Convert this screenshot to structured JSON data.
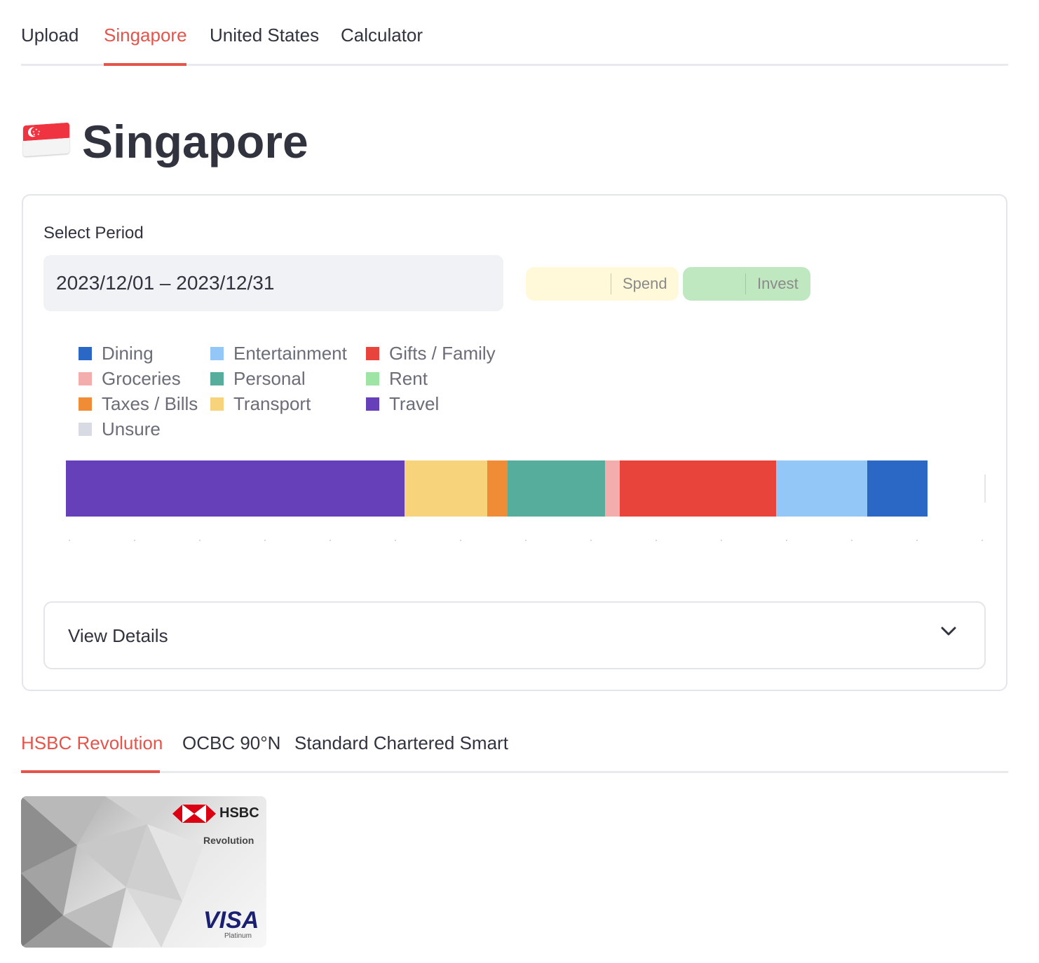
{
  "nav": {
    "tabs": [
      {
        "label": "Upload"
      },
      {
        "label": "Singapore"
      },
      {
        "label": "United States"
      },
      {
        "label": "Calculator"
      }
    ],
    "active": "Singapore"
  },
  "page": {
    "title": "Singapore"
  },
  "filters": {
    "period_label": "Select Period",
    "period_value": "2023/12/01 – 2023/12/31",
    "chips": [
      {
        "label": "Spend",
        "color": "#fff9d9"
      },
      {
        "label": "Invest",
        "color": "#c0e8c0"
      }
    ]
  },
  "chart_data": {
    "type": "bar",
    "orientation": "horizontal-stacked",
    "legend_placement": "top-left",
    "legend": [
      {
        "name": "Dining",
        "color": "#2b67c4"
      },
      {
        "name": "Entertainment",
        "color": "#93c7f7"
      },
      {
        "name": "Gifts / Family",
        "color": "#e9443b"
      },
      {
        "name": "Groceries",
        "color": "#f2adac"
      },
      {
        "name": "Personal",
        "color": "#57ad9c"
      },
      {
        "name": "Rent",
        "color": "#9ee4a4"
      },
      {
        "name": "Taxes / Bills",
        "color": "#f08c35"
      },
      {
        "name": "Transport",
        "color": "#f7d47c"
      },
      {
        "name": "Travel",
        "color": "#6640b8"
      },
      {
        "name": "Unsure",
        "color": "#d8dbe3"
      }
    ],
    "segments": [
      {
        "category": "Travel",
        "share": 0.368
      },
      {
        "category": "Transport",
        "share": 0.09
      },
      {
        "category": "Taxes / Bills",
        "share": 0.022
      },
      {
        "category": "Personal",
        "share": 0.106
      },
      {
        "category": "Groceries",
        "share": 0.016
      },
      {
        "category": "Gifts / Family",
        "share": 0.17
      },
      {
        "category": "Entertainment",
        "share": 0.099
      },
      {
        "category": "Dining",
        "share": 0.066
      }
    ],
    "total_share_of_axis": 0.937
  },
  "details": {
    "label": "View Details"
  },
  "cards": {
    "tabs": [
      {
        "label": "HSBC Revolution"
      },
      {
        "label": "OCBC 90°N"
      },
      {
        "label": "Standard Chartered Smart"
      }
    ],
    "active": "HSBC Revolution",
    "image": {
      "brand": "HSBC",
      "product": "Revolution",
      "network": "VISA",
      "tier": "Platinum"
    }
  }
}
